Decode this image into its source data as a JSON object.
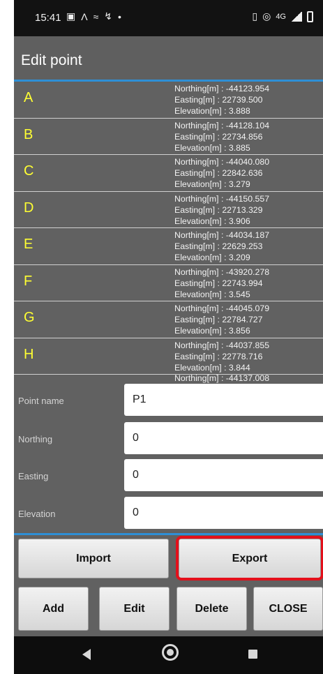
{
  "status": {
    "time": "15:41",
    "network": "4G",
    "left_icons": [
      "gallery-icon",
      "maps-icon",
      "chart-icon",
      "signal-strength-icon",
      "dot-icon"
    ],
    "right_icons": [
      "vibrate-icon",
      "hotspot-icon",
      "network-label",
      "cell-signal-icon",
      "battery-icon"
    ]
  },
  "dialog": {
    "title": "Edit point",
    "accent_color": "#2e8fd6",
    "point_name_color": "#ffff33"
  },
  "points": [
    {
      "name": "A",
      "northing": "Northing[m] : -44123.954",
      "easting": "Easting[m] : 22739.500",
      "elevation": "Elevation[m] : 3.888"
    },
    {
      "name": "B",
      "northing": "Northing[m] : -44128.104",
      "easting": "Easting[m] : 22734.856",
      "elevation": "Elevation[m] : 3.885"
    },
    {
      "name": "C",
      "northing": "Northing[m] : -44040.080",
      "easting": "Easting[m] : 22842.636",
      "elevation": "Elevation[m] : 3.279"
    },
    {
      "name": "D",
      "northing": "Northing[m] : -44150.557",
      "easting": "Easting[m] : 22713.329",
      "elevation": "Elevation[m] : 3.906"
    },
    {
      "name": "E",
      "northing": "Northing[m] : -44034.187",
      "easting": "Easting[m] : 22629.253",
      "elevation": "Elevation[m] : 3.209"
    },
    {
      "name": "F",
      "northing": "Northing[m] : -43920.278",
      "easting": "Easting[m] : 22743.994",
      "elevation": "Elevation[m] : 3.545"
    },
    {
      "name": "G",
      "northing": "Northing[m] : -44045.079",
      "easting": "Easting[m] : 22784.727",
      "elevation": "Elevation[m] : 3.856"
    },
    {
      "name": "H",
      "northing": "Northing[m] : -44037.855",
      "easting": "Easting[m] : 22778.716",
      "elevation": "Elevation[m] : 3.844"
    }
  ],
  "partial_row": {
    "northing": "Northing[m] : -44137.008"
  },
  "form": {
    "point_name_label": "Point name",
    "point_name_value": "P1",
    "northing_label": "Northing",
    "northing_value": "0",
    "easting_label": "Easting",
    "easting_value": "0",
    "elevation_label": "Elevation",
    "elevation_value": "0"
  },
  "buttons": {
    "import": "Import",
    "export": "Export",
    "add": "Add",
    "edit": "Edit",
    "delete": "Delete",
    "close": "CLOSE"
  },
  "highlight_color": "#e3101b"
}
